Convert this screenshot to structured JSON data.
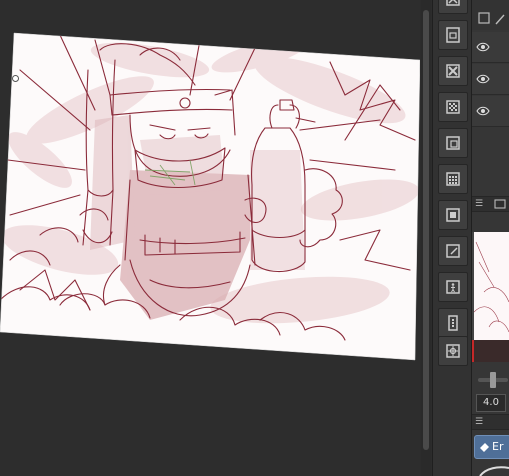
{
  "command_bar": {
    "buttons": [
      {
        "name": "layer-icon"
      },
      {
        "name": "file-icon"
      },
      {
        "name": "clear-icon"
      },
      {
        "name": "pattern-icon"
      },
      {
        "name": "frame-icon"
      },
      {
        "name": "grid-icon"
      },
      {
        "name": "screen-icon"
      },
      {
        "name": "edit-icon"
      },
      {
        "name": "figure-icon"
      },
      {
        "name": "ruler-icon"
      },
      {
        "name": "target-icon"
      }
    ]
  },
  "layers": {
    "rows": [
      {
        "visible": true
      },
      {
        "visible": true
      },
      {
        "visible": true
      }
    ]
  },
  "zoom": {
    "value": "4.0"
  },
  "tool": {
    "label": "Er"
  }
}
